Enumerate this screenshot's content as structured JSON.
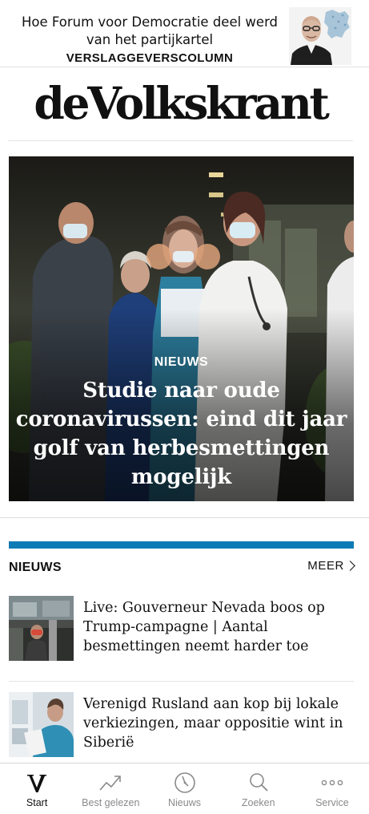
{
  "promo": {
    "text": "Hoe Forum voor Democratie deel werd van het partijkartel",
    "kicker": "VERSLAGGEVERSCOLUMN",
    "photo_icon": "columnist-portrait"
  },
  "masthead": {
    "title": "deVolkskrant"
  },
  "hero": {
    "kicker": "NIEUWS",
    "headline": "Studie naar oude coronavirussen: eind dit jaar golf van herbesmettingen mogelijk",
    "photo_icon": "hospital-staff-photo"
  },
  "section": {
    "title": "NIEUWS",
    "more_label": "MEER",
    "accent_color": "#0d7bb5"
  },
  "articles": [
    {
      "title": "Live: Gouverneur Nevada boos op Trump-campagne | Aantal besmettingen neemt harder toe",
      "thumb_icon": "bus-passenger-photo"
    },
    {
      "title": "Verenigd Rusland aan kop bij lokale verkiezingen, maar oppositie wint in Siberië",
      "thumb_icon": "voting-photo"
    }
  ],
  "tabbar": {
    "tabs": [
      {
        "label": "Start",
        "icon": "volkskrant-v-icon",
        "active": true
      },
      {
        "label": "Best gelezen",
        "icon": "trending-icon",
        "active": false
      },
      {
        "label": "Nieuws",
        "icon": "clock-icon",
        "active": false
      },
      {
        "label": "Zoeken",
        "icon": "search-icon",
        "active": false
      },
      {
        "label": "Service",
        "icon": "more-dots-icon",
        "active": false
      }
    ]
  }
}
